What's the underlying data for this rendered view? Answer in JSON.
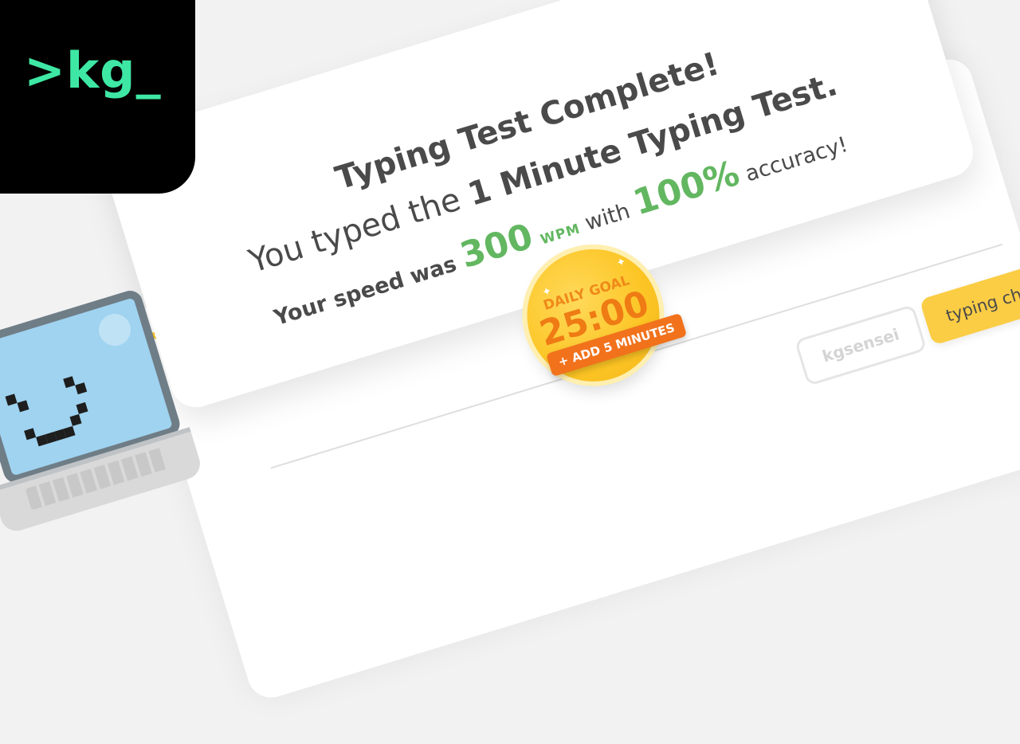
{
  "logo": {
    "text": ">kg_",
    "color": "#3ee8a4"
  },
  "results": {
    "title": "Typing Test Complete!",
    "line2_prefix": "You typed the ",
    "line2_bold": "1 Minute Typing Test.",
    "speed_prefix": "Your speed was ",
    "speed_value": "300",
    "speed_unit": "WPM",
    "with_text": " with ",
    "accuracy_value": "100%",
    "accuracy_suffix": " accuracy!"
  },
  "daily_goal": {
    "label": "DAILY GOAL",
    "time": "25:00",
    "add_button": "+ ADD 5 MINUTES"
  },
  "buttons": {
    "kgsensei": "kgsensei",
    "typing_cheats": "typing cheats"
  },
  "colors": {
    "accent_green": "#62b760",
    "goal_yellow": "#fcc524",
    "goal_orange": "#f2721c",
    "cheats_button": "#fbcd45"
  }
}
